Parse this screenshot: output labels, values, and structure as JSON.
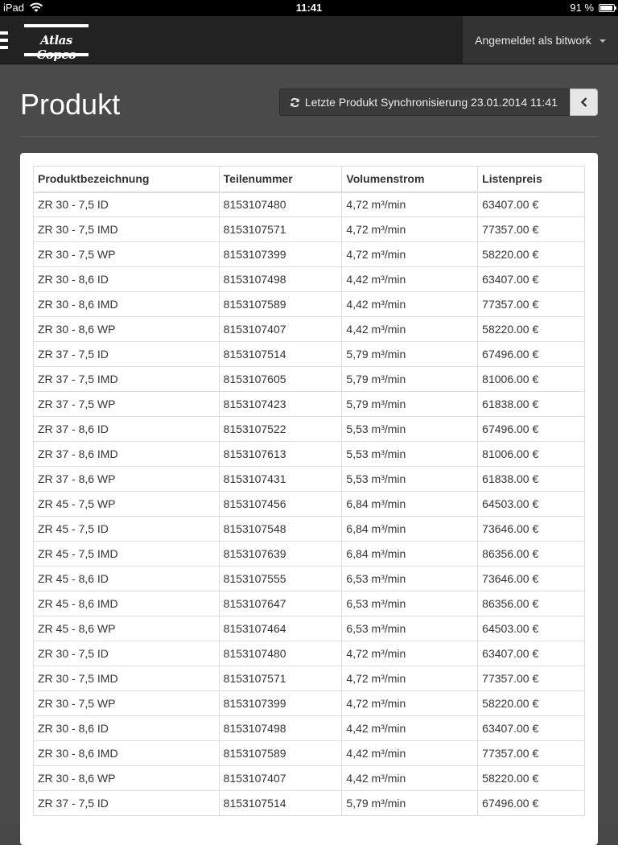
{
  "status_bar": {
    "device": "iPad",
    "time": "11:41",
    "battery": "91 %",
    "battery_level": 0.91
  },
  "navbar": {
    "logo_text": "Atlas Copco",
    "user_label": "Angemeldet als bitwork"
  },
  "page": {
    "title": "Produkt",
    "sync_label": "Letzte Produkt Synchronisierung 23.01.2014 11:41"
  },
  "table": {
    "headers": {
      "name": "Produktbezeichnung",
      "part": "Teilenummer",
      "flow": "Volumenstrom",
      "price": "Listenpreis"
    },
    "rows": [
      {
        "name": "ZR 30 - 7,5 ID",
        "part": "8153107480",
        "flow": "4,72 m³/min",
        "price": "63407.00 €"
      },
      {
        "name": "ZR 30 - 7,5 IMD",
        "part": "8153107571",
        "flow": "4,72 m³/min",
        "price": "77357.00 €"
      },
      {
        "name": "ZR 30 - 7,5 WP",
        "part": "8153107399",
        "flow": "4,72 m³/min",
        "price": "58220.00 €"
      },
      {
        "name": "ZR 30 - 8,6 ID",
        "part": "8153107498",
        "flow": "4,42 m³/min",
        "price": "63407.00 €"
      },
      {
        "name": "ZR 30 - 8,6 IMD",
        "part": "8153107589",
        "flow": "4,42 m³/min",
        "price": "77357.00 €"
      },
      {
        "name": "ZR 30 - 8,6 WP",
        "part": "8153107407",
        "flow": "4,42 m³/min",
        "price": "58220.00 €"
      },
      {
        "name": "ZR 37 - 7,5 ID",
        "part": "8153107514",
        "flow": "5,79 m³/min",
        "price": "67496.00 €"
      },
      {
        "name": "ZR 37 - 7,5 IMD",
        "part": "8153107605",
        "flow": "5,79 m³/min",
        "price": "81006.00 €"
      },
      {
        "name": "ZR 37 - 7,5 WP",
        "part": "8153107423",
        "flow": "5,79 m³/min",
        "price": "61838.00 €"
      },
      {
        "name": "ZR 37 - 8,6 ID",
        "part": "8153107522",
        "flow": "5,53 m³/min",
        "price": "67496.00 €"
      },
      {
        "name": "ZR 37 - 8,6 IMD",
        "part": "8153107613",
        "flow": "5,53 m³/min",
        "price": "81006.00 €"
      },
      {
        "name": "ZR 37 - 8,6 WP",
        "part": "8153107431",
        "flow": "5,53 m³/min",
        "price": "61838.00 €"
      },
      {
        "name": "ZR 45 - 7,5 WP",
        "part": "8153107456",
        "flow": "6,84 m³/min",
        "price": "64503.00 €"
      },
      {
        "name": "ZR 45 - 7,5 ID",
        "part": "8153107548",
        "flow": "6,84 m³/min",
        "price": "73646.00 €"
      },
      {
        "name": "ZR 45 - 7,5 IMD",
        "part": "8153107639",
        "flow": "6,84 m³/min",
        "price": "86356.00 €"
      },
      {
        "name": "ZR 45 - 8,6 ID",
        "part": "8153107555",
        "flow": "6,53 m³/min",
        "price": "73646.00 €"
      },
      {
        "name": "ZR 45 - 8,6 IMD",
        "part": "8153107647",
        "flow": "6,53 m³/min",
        "price": "86356.00 €"
      },
      {
        "name": "ZR 45 - 8,6 WP",
        "part": "8153107464",
        "flow": "6,53 m³/min",
        "price": "64503.00 €"
      },
      {
        "name": "ZR 30 - 7,5 ID",
        "part": "8153107480",
        "flow": "4,72 m³/min",
        "price": "63407.00 €"
      },
      {
        "name": "ZR 30 - 7,5 IMD",
        "part": "8153107571",
        "flow": "4,72 m³/min",
        "price": "77357.00 €"
      },
      {
        "name": "ZR 30 - 7,5 WP",
        "part": "8153107399",
        "flow": "4,72 m³/min",
        "price": "58220.00 €"
      },
      {
        "name": "ZR 30 - 8,6 ID",
        "part": "8153107498",
        "flow": "4,42 m³/min",
        "price": "63407.00 €"
      },
      {
        "name": "ZR 30 - 8,6 IMD",
        "part": "8153107589",
        "flow": "4,42 m³/min",
        "price": "77357.00 €"
      },
      {
        "name": "ZR 30 - 8,6 WP",
        "part": "8153107407",
        "flow": "4,42 m³/min",
        "price": "58220.00 €"
      },
      {
        "name": "ZR 37 - 7,5 ID",
        "part": "8153107514",
        "flow": "5,79 m³/min",
        "price": "67496.00 €"
      }
    ]
  }
}
